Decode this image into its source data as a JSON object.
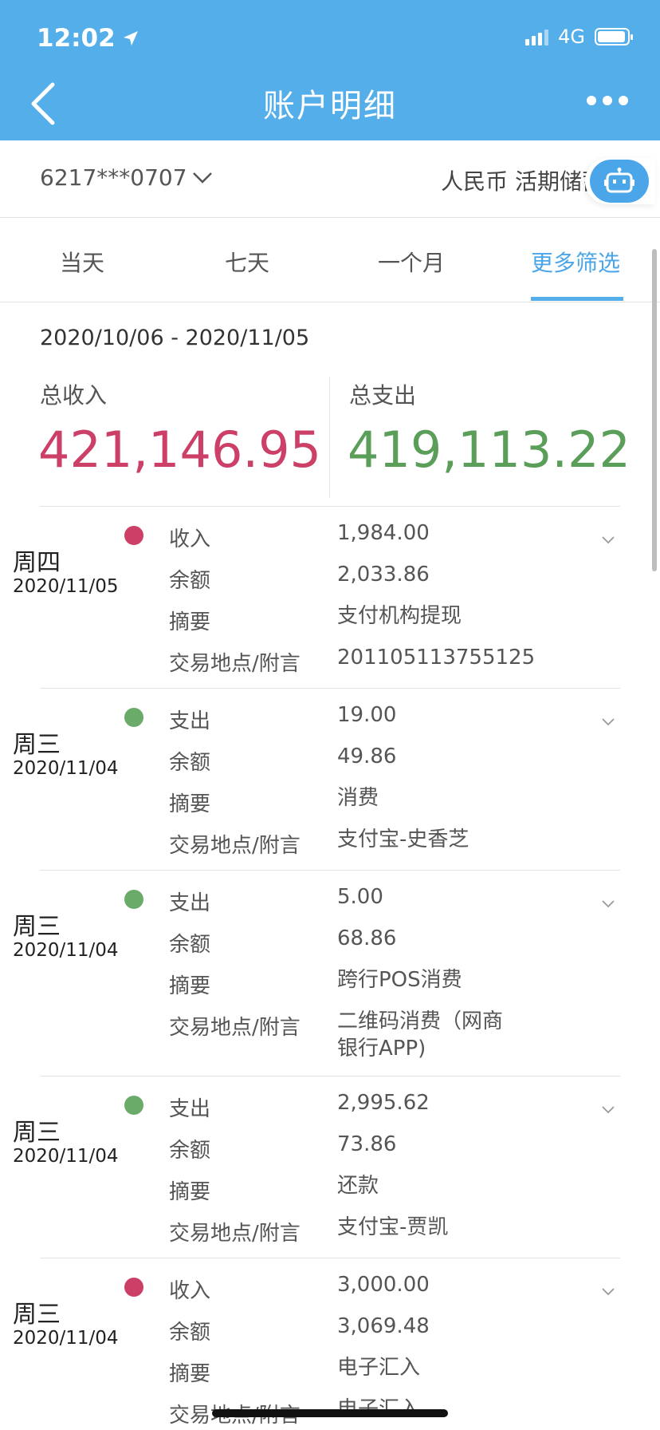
{
  "status": {
    "time": "12:02",
    "network": "4G"
  },
  "header": {
    "title": "账户明细"
  },
  "account": {
    "number": "6217***0707",
    "type": "人民币 活期储蓄"
  },
  "tabs": [
    "当天",
    "七天",
    "一个月",
    "更多筛选"
  ],
  "active_tab": "更多筛选",
  "date_range": "2020/10/06 - 2020/11/05",
  "summary": {
    "income_label": "总收入",
    "income_value": "421,146.95",
    "expense_label": "总支出",
    "expense_value": "419,113.22"
  },
  "field_labels": {
    "balance": "余额",
    "summary": "摘要",
    "location": "交易地点/附言"
  },
  "transactions": [
    {
      "weekday": "周四",
      "date": "2020/11/05",
      "type": "收入",
      "amount": "1,984.00",
      "balance": "2,033.86",
      "summary": "支付机构提现",
      "location": "201105113755125"
    },
    {
      "weekday": "周三",
      "date": "2020/11/04",
      "type": "支出",
      "amount": "19.00",
      "balance": "49.86",
      "summary": "消费",
      "location": "支付宝-史香芝"
    },
    {
      "weekday": "周三",
      "date": "2020/11/04",
      "type": "支出",
      "amount": "5.00",
      "balance": "68.86",
      "summary": "跨行POS消费",
      "location": "二维码消费（网商",
      "location_line2": "银行APP)"
    },
    {
      "weekday": "周三",
      "date": "2020/11/04",
      "type": "支出",
      "amount": "2,995.62",
      "balance": "73.86",
      "summary": "还款",
      "location": "支付宝-贾凯"
    },
    {
      "weekday": "周三",
      "date": "2020/11/04",
      "type": "收入",
      "amount": "3,000.00",
      "balance": "3,069.48",
      "summary": "电子汇入",
      "location": "电子汇入"
    }
  ],
  "colors": {
    "header": "#54aeea",
    "accent": "#4aa6e8",
    "income": "#cc4068",
    "expense": "#5a9e5a"
  }
}
